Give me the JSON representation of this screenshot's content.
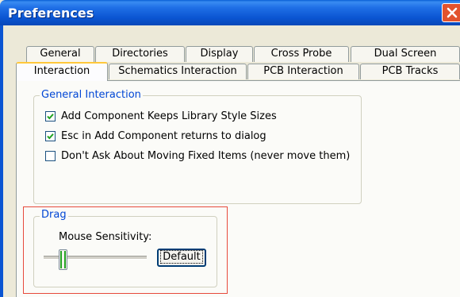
{
  "window": {
    "title": "Preferences",
    "close_icon": "close-icon",
    "titlebar_color": "#0b55d2",
    "close_color": "#e2532e"
  },
  "tabs": {
    "row1": [
      {
        "label": "General"
      },
      {
        "label": "Directories"
      },
      {
        "label": "Display"
      },
      {
        "label": "Cross Probe"
      },
      {
        "label": "Dual Screen"
      }
    ],
    "row2": [
      {
        "label": "Interaction",
        "active": true
      },
      {
        "label": "Schematics Interaction"
      },
      {
        "label": "PCB Interaction"
      },
      {
        "label": "PCB Tracks"
      }
    ]
  },
  "general_interaction": {
    "legend": "General Interaction",
    "options": [
      {
        "label": "Add Component Keeps Library Style Sizes",
        "checked": true
      },
      {
        "label": "Esc in Add Component returns to dialog",
        "checked": true
      },
      {
        "label": "Don't Ask About Moving Fixed Items (never move them)",
        "checked": false
      }
    ]
  },
  "drag": {
    "legend": "Drag",
    "sensitivity_label": "Mouse Sensitivity:",
    "sensitivity_level": 0.15,
    "default_button": "Default"
  },
  "colors": {
    "legend_text": "#0046d5",
    "tab_active_accent": "#ffc83c",
    "highlight_border": "#e74a3c",
    "check_color": "#21a121"
  }
}
